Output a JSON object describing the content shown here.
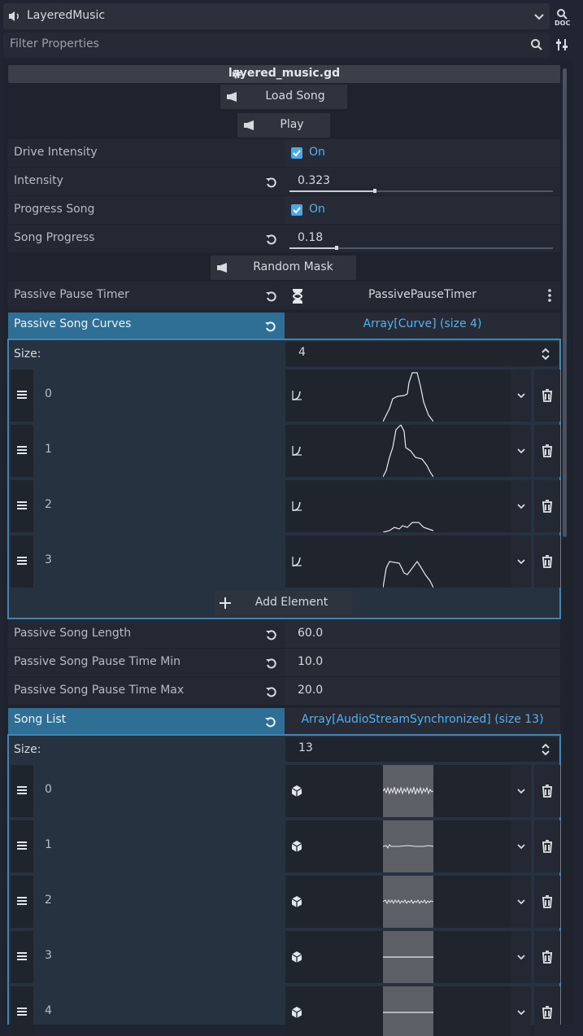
{
  "header": {
    "node_name": "LayeredMusic",
    "filter_placeholder": "Filter Properties"
  },
  "script": {
    "name": "layered_music.gd"
  },
  "buttons": {
    "load_song": "Load Song",
    "play": "Play",
    "random_mask": "Random Mask",
    "add_element": "Add Element"
  },
  "properties": {
    "drive_intensity": {
      "label": "Drive Intensity",
      "value": "On"
    },
    "intensity": {
      "label": "Intensity",
      "value": "0.323",
      "fraction": 0.323
    },
    "progress_song": {
      "label": "Progress Song",
      "value": "On"
    },
    "song_progress": {
      "label": "Song Progress",
      "value": "0.18",
      "fraction": 0.18
    },
    "passive_pause_timer": {
      "label": "Passive Pause Timer",
      "value": "PassivePauseTimer"
    },
    "passive_song_length": {
      "label": "Passive Song Length",
      "value": "60.0"
    },
    "passive_song_pause_time_min": {
      "label": "Passive Song Pause Time Min",
      "value": "10.0"
    },
    "passive_song_pause_time_max": {
      "label": "Passive Song Pause Time Max",
      "value": "20.0"
    }
  },
  "passive_song_curves": {
    "label": "Passive Song Curves",
    "summary": "Array[Curve] (size 4)",
    "size_label": "Size:",
    "size": "4",
    "items": [
      "0",
      "1",
      "2",
      "3"
    ]
  },
  "song_list": {
    "label": "Song List",
    "summary": "Array[AudioStreamSynchronized] (size 13)",
    "size_label": "Size:",
    "size": "13",
    "items": [
      "0",
      "1",
      "2",
      "3",
      "4"
    ]
  },
  "colors": {
    "accent": "#4aa8e6",
    "array_header": "#2f6f95",
    "array_border": "#3c86b8"
  },
  "icons": {
    "node": "speaker-icon",
    "doc": "doc-icon",
    "search": "search-icon",
    "tools": "tools-icon",
    "script": "gear-icon",
    "revert": "revert-icon",
    "timer": "hourglass-icon",
    "curve": "curve-icon",
    "audio": "cube-icon",
    "delete": "trash-icon",
    "drag": "drag-handle-icon"
  }
}
